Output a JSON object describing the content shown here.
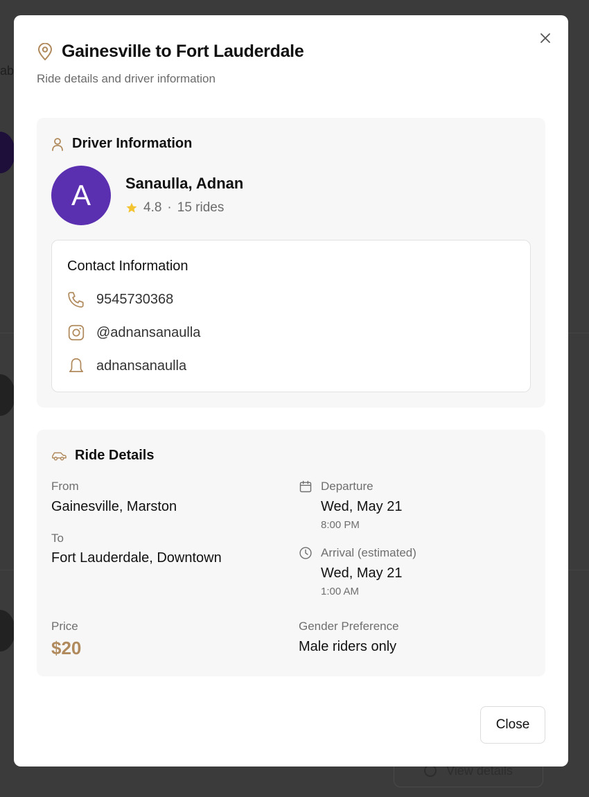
{
  "background": {
    "fragment_text": "abl",
    "view_details_label": "View details"
  },
  "modal": {
    "title": "Gainesville to Fort Lauderdale",
    "subtitle": "Ride details and driver information",
    "close_button_label": "Close"
  },
  "driver": {
    "section_title": "Driver Information",
    "avatar_letter": "A",
    "name": "Sanaulla, Adnan",
    "rating": "4.8",
    "separator": "·",
    "rides": "15 rides"
  },
  "contact": {
    "title": "Contact Information",
    "phone": "9545730368",
    "instagram": "@adnansanaulla",
    "snapchat": "adnansanaulla"
  },
  "ride": {
    "section_title": "Ride Details",
    "from_label": "From",
    "from_value": "Gainesville, Marston",
    "to_label": "To",
    "to_value": "Fort Lauderdale, Downtown",
    "departure_label": "Departure",
    "departure_date": "Wed, May 21",
    "departure_time": "8:00 PM",
    "arrival_label": "Arrival (estimated)",
    "arrival_date": "Wed, May 21",
    "arrival_time": "1:00 AM",
    "price_label": "Price",
    "price_value": "$20",
    "gender_label": "Gender Preference",
    "gender_value": "Male riders only"
  },
  "colors": {
    "accent": "#b08a5c",
    "avatar": "#5b30b0",
    "star": "#f4c430",
    "card_bg": "#f7f7f7"
  },
  "icons": [
    "map-pin-icon",
    "close-icon",
    "user-icon",
    "star-icon",
    "phone-icon",
    "instagram-icon",
    "snapchat-icon",
    "car-icon",
    "calendar-icon",
    "clock-icon"
  ]
}
